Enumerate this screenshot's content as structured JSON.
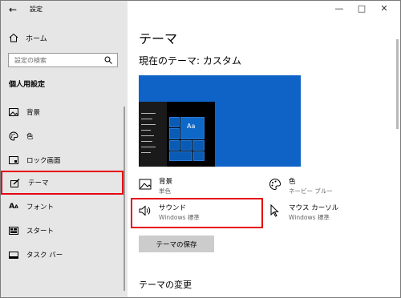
{
  "window": {
    "title": "設定",
    "back_icon": "back-arrow-icon",
    "controls": [
      "minimize-icon",
      "maximize-icon",
      "close-icon"
    ]
  },
  "sidebar": {
    "home_label": "ホーム",
    "search_placeholder": "設定の検索",
    "section_title": "個人用設定",
    "items": [
      {
        "label": "背景",
        "icon": "picture-icon"
      },
      {
        "label": "色",
        "icon": "palette-icon"
      },
      {
        "label": "ロック画面",
        "icon": "lock-screen-icon"
      },
      {
        "label": "テーマ",
        "icon": "theme-brush-icon",
        "active": true
      },
      {
        "label": "フォント",
        "icon": "font-icon"
      },
      {
        "label": "スタート",
        "icon": "start-icon"
      },
      {
        "label": "タスク バー",
        "icon": "taskbar-icon"
      }
    ]
  },
  "main": {
    "title": "テーマ",
    "current_theme": "現在のテーマ: カスタム",
    "preview_tile_label": "Aa",
    "options": {
      "background": {
        "label": "背景",
        "value": "単色"
      },
      "color": {
        "label": "色",
        "value": "ネービー ブルー"
      },
      "sound": {
        "label": "サウンド",
        "value": "Windows 標準"
      },
      "mouse_cursor": {
        "label": "マウス カーソル",
        "value": "Windows 標準"
      }
    },
    "save_button": "テーマの保存",
    "change_heading": "テーマの変更"
  },
  "colors": {
    "highlight_red": "#e60012",
    "preview_blue": "#1063c6",
    "sidebar_bg": "#e6e6e6"
  }
}
